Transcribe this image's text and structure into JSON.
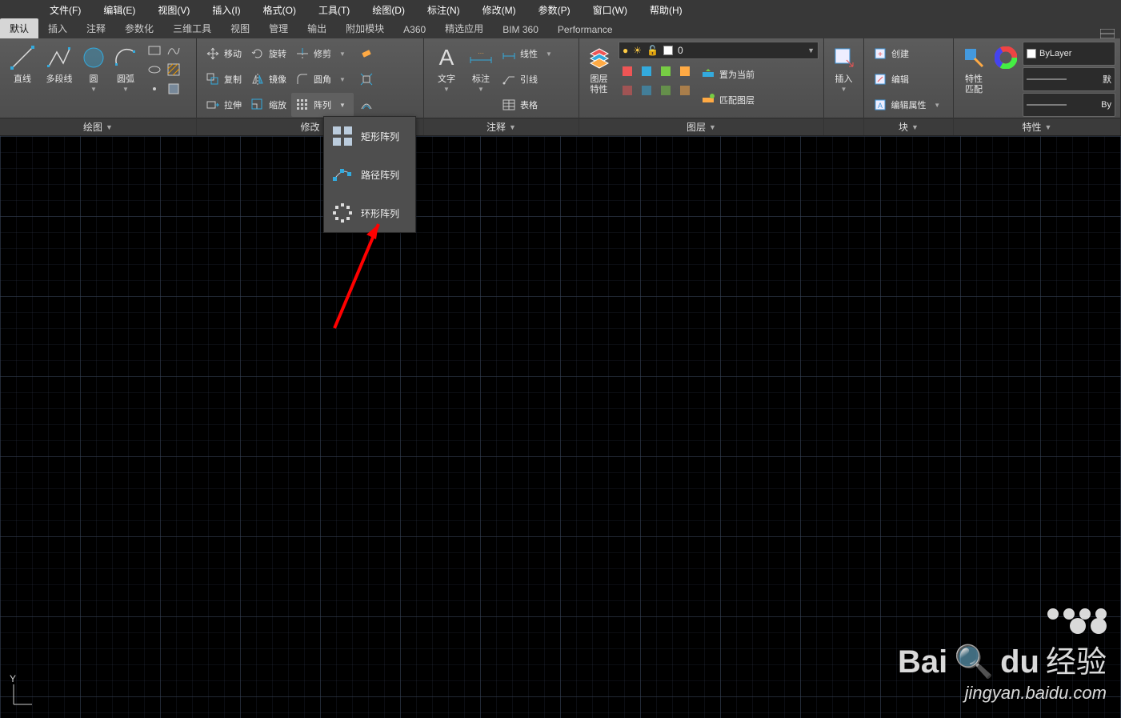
{
  "menus": {
    "file": "文件(F)",
    "edit": "编辑(E)",
    "view": "视图(V)",
    "insert": "插入(I)",
    "format": "格式(O)",
    "tools": "工具(T)",
    "draw": "绘图(D)",
    "dim": "标注(N)",
    "modify": "修改(M)",
    "param": "参数(P)",
    "window": "窗口(W)",
    "help": "帮助(H)"
  },
  "tabs": {
    "default": "默认",
    "insert": "插入",
    "annotate": "注释",
    "parametric": "参数化",
    "tools3d": "三维工具",
    "view": "视图",
    "manage": "管理",
    "output": "输出",
    "addins": "附加模块",
    "a360": "A360",
    "featured": "精选应用",
    "bim360": "BIM 360",
    "performance": "Performance"
  },
  "panels": {
    "draw": {
      "title": "绘图",
      "line": "直线",
      "polyline": "多段线",
      "circle": "圆",
      "arc": "圆弧"
    },
    "modify": {
      "title": "修改",
      "move": "移动",
      "rotate": "旋转",
      "trim": "修剪",
      "copy": "复制",
      "mirror": "镜像",
      "fillet": "圆角",
      "stretch": "拉伸",
      "scale": "缩放",
      "array": "阵列"
    },
    "annotate": {
      "title": "注释",
      "text": "文字",
      "dim": "标注",
      "linear": "线性",
      "leader": "引线",
      "table": "表格"
    },
    "layers": {
      "title": "图层",
      "layerprop": "图层\n特性",
      "current_name": "0",
      "setcurrent": "置为当前",
      "matchlayer": "匹配图层"
    },
    "insert": {
      "title": "插入",
      "insert_btn": "插入"
    },
    "block": {
      "title": "块",
      "create": "创建",
      "edit": "编辑",
      "editattr": "编辑属性"
    },
    "properties": {
      "title": "特性",
      "match": "特性\n匹配",
      "bylayer": "ByLayer",
      "default": "默",
      "bylayer2": "By"
    }
  },
  "array_popup": {
    "rect": "矩形阵列",
    "path": "路径阵列",
    "polar": "环形阵列"
  },
  "watermark": {
    "brand": "Bai",
    "brand2": "du",
    "cn": "经验",
    "url": "jingyan.baidu.com"
  },
  "axis_y": "Y"
}
